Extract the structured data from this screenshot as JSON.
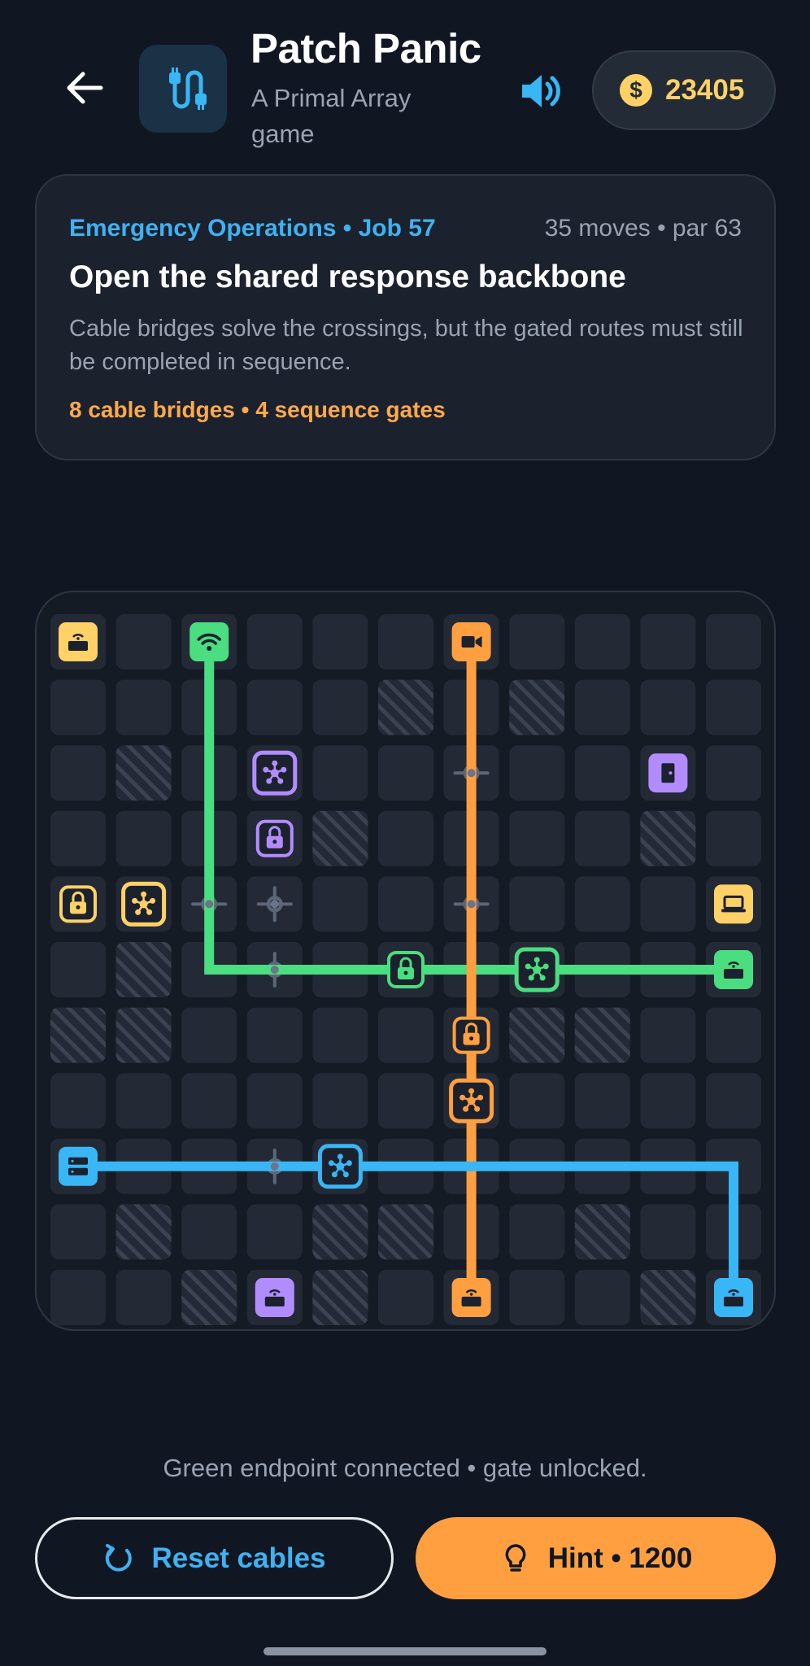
{
  "header": {
    "back_icon": "arrow-left-icon",
    "app_icon": "cable-icon",
    "title": "Patch Panic",
    "subtitle": "A Primal Array game",
    "sound_icon": "speaker-icon",
    "coin_icon": "dollar-coin-icon",
    "coins": "23405"
  },
  "job": {
    "meta": "Emergency Operations • Job 57",
    "moves": "35 moves • par 63",
    "title": "Open the shared response backbone",
    "description": "Cable bridges solve the crossings, but the gated routes must still be completed in sequence.",
    "features": "8 cable bridges • 4 sequence gates"
  },
  "board": {
    "cols": 11,
    "rows": 11,
    "colors": {
      "yellow": "#ffd166",
      "green": "#4ade80",
      "orange": "#ff9f40",
      "blue": "#38b6f5",
      "purple": "#b28cff"
    },
    "blocked": [
      [
        1,
        5
      ],
      [
        1,
        7
      ],
      [
        2,
        1
      ],
      [
        3,
        4
      ],
      [
        3,
        9
      ],
      [
        5,
        1
      ],
      [
        6,
        0
      ],
      [
        6,
        1
      ],
      [
        6,
        7
      ],
      [
        6,
        8
      ],
      [
        9,
        1
      ],
      [
        9,
        4
      ],
      [
        9,
        5
      ],
      [
        9,
        8
      ],
      [
        10,
        2
      ],
      [
        10,
        4
      ],
      [
        10,
        9
      ]
    ],
    "bridges": [
      [
        2,
        6
      ],
      [
        4,
        2
      ],
      [
        4,
        3
      ],
      [
        4,
        6
      ],
      [
        5,
        3
      ],
      [
        8,
        3
      ]
    ],
    "pieces": [
      {
        "r": 0,
        "c": 0,
        "color": "yellow",
        "kind": "router",
        "style": "endpoint"
      },
      {
        "r": 0,
        "c": 2,
        "color": "green",
        "kind": "wifi",
        "style": "endpoint"
      },
      {
        "r": 0,
        "c": 6,
        "color": "orange",
        "kind": "camera",
        "style": "endpoint"
      },
      {
        "r": 2,
        "c": 3,
        "color": "purple",
        "kind": "hub",
        "style": "hub"
      },
      {
        "r": 2,
        "c": 9,
        "color": "purple",
        "kind": "door",
        "style": "endpoint"
      },
      {
        "r": 3,
        "c": 3,
        "color": "purple",
        "kind": "lock",
        "style": "gate"
      },
      {
        "r": 4,
        "c": 0,
        "color": "yellow",
        "kind": "lock",
        "style": "gate"
      },
      {
        "r": 4,
        "c": 1,
        "color": "yellow",
        "kind": "hub",
        "style": "hub"
      },
      {
        "r": 4,
        "c": 10,
        "color": "yellow",
        "kind": "laptop",
        "style": "endpoint"
      },
      {
        "r": 5,
        "c": 5,
        "color": "green",
        "kind": "lock",
        "style": "gate"
      },
      {
        "r": 5,
        "c": 7,
        "color": "green",
        "kind": "hub",
        "style": "hub"
      },
      {
        "r": 5,
        "c": 10,
        "color": "green",
        "kind": "router",
        "style": "endpoint"
      },
      {
        "r": 6,
        "c": 6,
        "color": "orange",
        "kind": "lock",
        "style": "gate"
      },
      {
        "r": 7,
        "c": 6,
        "color": "orange",
        "kind": "hub",
        "style": "hub"
      },
      {
        "r": 8,
        "c": 0,
        "color": "blue",
        "kind": "server",
        "style": "endpoint"
      },
      {
        "r": 8,
        "c": 4,
        "color": "blue",
        "kind": "hub",
        "style": "hub"
      },
      {
        "r": 10,
        "c": 3,
        "color": "purple",
        "kind": "router",
        "style": "endpoint"
      },
      {
        "r": 10,
        "c": 6,
        "color": "orange",
        "kind": "router",
        "style": "endpoint"
      },
      {
        "r": 10,
        "c": 10,
        "color": "blue",
        "kind": "router",
        "style": "endpoint"
      }
    ],
    "paths": [
      {
        "color": "green",
        "points": [
          [
            0,
            2
          ],
          [
            5,
            2
          ],
          [
            5,
            10
          ]
        ]
      },
      {
        "color": "orange",
        "points": [
          [
            0,
            6
          ],
          [
            10,
            6
          ]
        ]
      },
      {
        "color": "blue",
        "points": [
          [
            8,
            0
          ],
          [
            8,
            10
          ],
          [
            10,
            10
          ]
        ]
      }
    ]
  },
  "status": "Green endpoint connected • gate unlocked.",
  "buttons": {
    "reset_icon": "refresh-icon",
    "reset_label": "Reset cables",
    "hint_icon": "lightbulb-icon",
    "hint_label": "Hint • 1200"
  }
}
